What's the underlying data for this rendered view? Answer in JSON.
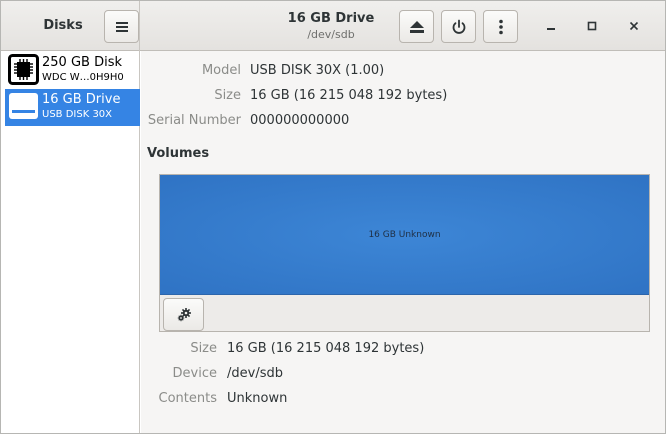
{
  "app": {
    "title": "Disks"
  },
  "window": {
    "title": "16 GB Drive",
    "subtitle": "/dev/sdb"
  },
  "header": {
    "menu_icon": "hamburger-menu-icon",
    "eject_icon": "eject-icon",
    "power_icon": "power-icon",
    "more_icon": "vertical-dots-icon",
    "minimize_icon": "minimize-icon",
    "maximize_icon": "maximize-icon",
    "close_icon": "close-icon"
  },
  "sidebar": {
    "drives": [
      {
        "name": "250 GB Disk",
        "model": "WDC W…0H9H0",
        "icon": "hard-disk-icon",
        "selected": false
      },
      {
        "name": "16 GB Drive",
        "model": "USB DISK 30X",
        "icon": "usb-drive-icon",
        "selected": true
      }
    ]
  },
  "drive_info": {
    "model_label": "Model",
    "model_value": "USB DISK 30X (1.00)",
    "size_label": "Size",
    "size_value": "16 GB (16 215 048 192 bytes)",
    "serial_label": "Serial Number",
    "serial_value": "000000000000"
  },
  "volumes": {
    "heading": "Volumes",
    "bar_label": "16 GB Unknown",
    "options_icon": "gear-icon"
  },
  "volume_info": {
    "size_label": "Size",
    "size_value": "16 GB (16 215 048 192 bytes)",
    "device_label": "Device",
    "device_value": "/dev/sdb",
    "contents_label": "Contents",
    "contents_value": "Unknown"
  },
  "colors": {
    "selection": "#3584e4",
    "volume_bar": "#3a7fd4",
    "background": "#f6f5f4"
  }
}
